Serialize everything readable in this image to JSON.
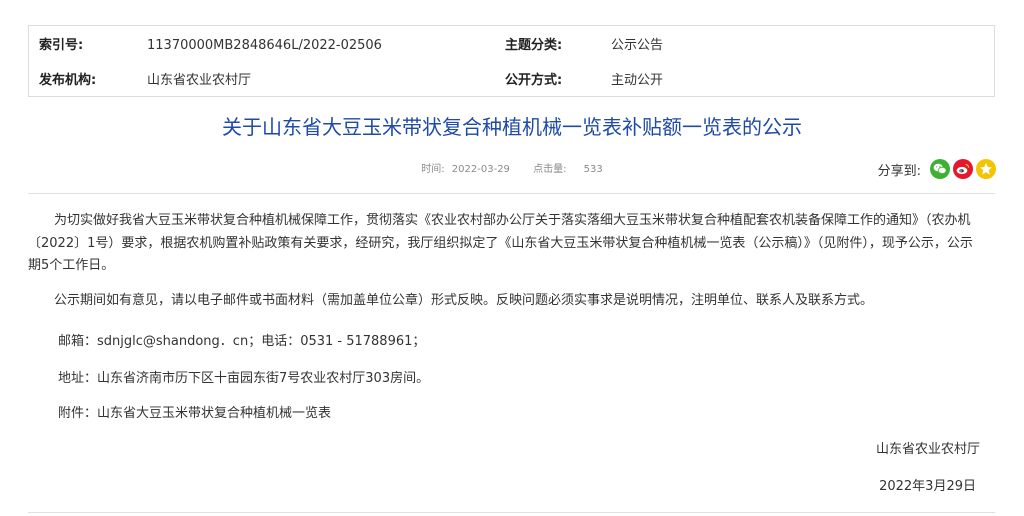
{
  "meta": {
    "index_label": "索引号:",
    "index_value": "11370000MB2848646L/2022-02506",
    "topic_label": "主题分类:",
    "topic_value": "公示公告",
    "publisher_label": "发布机构:",
    "publisher_value": "山东省农业农村厅",
    "disclosure_label": "公开方式:",
    "disclosure_value": "主动公开"
  },
  "article": {
    "title": "关于山东省大豆玉米带状复合种植机械一览表补贴额一览表的公示",
    "time_label": "时间:",
    "time_value": "2022-03-29",
    "clicks_label": "点击量:",
    "clicks_value": "533",
    "share_label": "分享到:",
    "paragraphs": {
      "p1": "为切实做好我省大豆玉米带状复合种植机械保障工作，贯彻落实《农业农村部办公厅关于落实落细大豆玉米带状复合种植配套农机装备保障工作的通知》（农办机〔2022〕1号）要求，根据农机购置补贴政策有关要求，经研究，我厅组织拟定了《山东省大豆玉米带状复合种植机械一览表（公示稿）》（见附件），现予公示，公示期5个工作日。",
      "p2": "公示期间如有意见，请以电子邮件或书面材料（需加盖单位公章）形式反映。反映问题必须实事求是说明情况，注明单位、联系人及联系方式。",
      "email": "邮箱：sdnjglc@shandong．cn；电话：0531 - 51788961；",
      "address": "地址：山东省济南市历下区十亩园东街7号农业农村厅303房间。",
      "attachment_label": "附件：",
      "attachment_link": "山东省大豆玉米带状复合种植机械一览表"
    },
    "signature": "山东省农业农村厅",
    "date": "2022年3月29日"
  },
  "share_icons": [
    "wechat-icon",
    "weibo-icon",
    "qzone-icon"
  ],
  "colors": {
    "title": "#1f4aa8",
    "wechat": "#3eb135",
    "weibo": "#e6162d",
    "qzone": "#f5c400"
  }
}
